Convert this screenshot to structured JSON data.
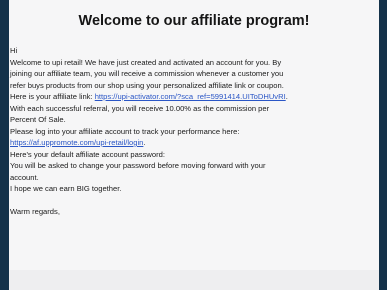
{
  "email": {
    "title": "Welcome to our affiliate program!",
    "greeting": "Hi",
    "p1_l1": "Welcome to upi retail! We have just created and activated an account for you. By",
    "p1_l2": "joining our affiliate team, you will receive a commission whenever a customer you",
    "p1_l3": "refer buys products from our shop using your personalized affiliate link or coupon.",
    "p1_l4_prefix": "Here is your affiliate link: ",
    "affiliate_link": "https://upi-activator.com/?sca_ref=5991414.UIToDHUvRI",
    "p1_l4_suffix": ".",
    "p1_l5": "With each successful referral, you will receive 10.00% as the commission per",
    "p1_l6": "Percent Of Sale.",
    "p2_l1": "Please log into your affiliate account to track your performance here:",
    "login_link": "https://af.uppromote.com/upi-retail/login",
    "login_suffix": ".",
    "p3_l1": "Here's your default affiliate account password:",
    "p3_l2": "You will be asked to change your password before moving forward with your",
    "p3_l3": "account.",
    "p4_l1": "I hope we can earn BIG together.",
    "closing": "Warm regards,"
  },
  "colors": {
    "frame": "#14324a",
    "card": "#f6f6f7",
    "link": "#2a56c6",
    "text": "#1c1c1c"
  }
}
